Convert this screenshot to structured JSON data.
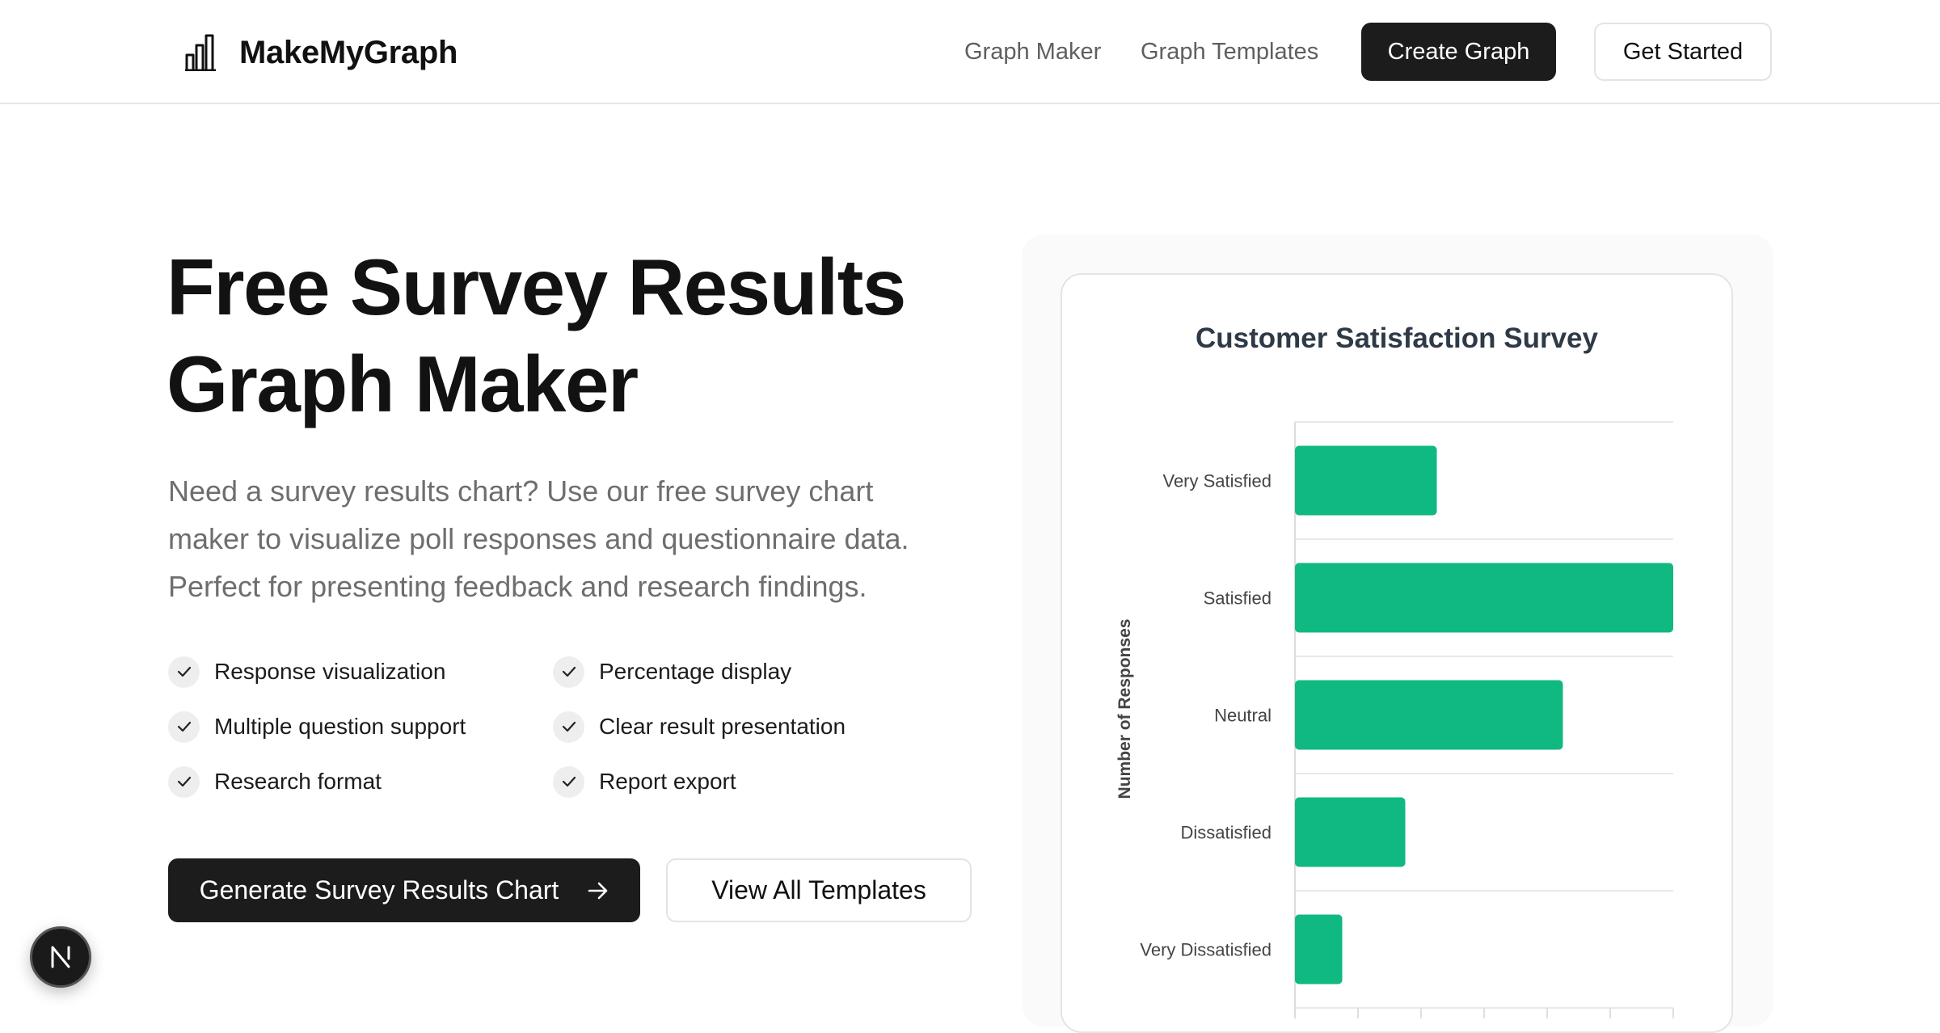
{
  "brand": {
    "name": "MakeMyGraph",
    "icon": "bar-chart-icon"
  },
  "nav": {
    "graph_maker": "Graph Maker",
    "graph_templates": "Graph Templates",
    "create_graph": "Create Graph",
    "get_started": "Get Started"
  },
  "hero": {
    "title_line1": "Free Survey Results",
    "title_line2": "Graph Maker",
    "description": "Need a survey results chart? Use our free survey chart maker to visualize poll responses and questionnaire data. Perfect for presenting feedback and research findings.",
    "features": [
      "Response visualization",
      "Percentage display",
      "Multiple question support",
      "Clear result presentation",
      "Research format",
      "Report export"
    ],
    "primary_cta": "Generate Survey Results Chart",
    "secondary_cta": "View All Templates"
  },
  "badge": {
    "letter": "N"
  },
  "colors": {
    "accent": "#10b981",
    "dark": "#1c1c1c",
    "muted": "#6e6e6e"
  },
  "chart_data": {
    "type": "bar",
    "orientation": "horizontal",
    "title": "Customer Satisfaction Survey",
    "ylabel": "Number of Responses",
    "categories": [
      "Very Satisfied",
      "Satisfied",
      "Neutral",
      "Dissatisfied",
      "Very Dissatisfied"
    ],
    "values": [
      45,
      120,
      85,
      35,
      15
    ],
    "xlim": [
      0,
      120
    ],
    "grid": true,
    "color": "#10b981"
  }
}
